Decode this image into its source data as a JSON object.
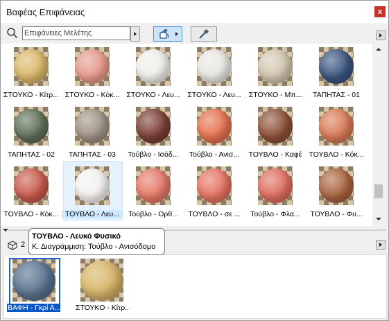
{
  "window": {
    "title": "Βαφέας Επιφάνειας",
    "close": "x"
  },
  "search": {
    "value": "Επιφάνειες Μελέτης"
  },
  "colors": {
    "accent": "#1e63d2",
    "close": "#c9302c"
  },
  "materials": [
    {
      "label": "ΣΤΟΥΚΟ - Κίτρ...",
      "color": "#d9b76a"
    },
    {
      "label": "ΣΤΟΥΚΟ - Κόκ...",
      "color": "#e59a8a"
    },
    {
      "label": "ΣΤΟΥΚΟ - Λευ...",
      "color": "#eeeeea"
    },
    {
      "label": "ΣΤΟΥΚΟ - Λευ...",
      "color": "#e8e6e0"
    },
    {
      "label": "ΣΤΟΥΚΟ - Μπ...",
      "color": "#d2c6b0"
    },
    {
      "label": "ΤΑΠΗΤΑΣ - 01",
      "color": "#3b5580"
    },
    {
      "label": "ΤΑΠΗΤΑΣ - 02",
      "color": "#5f6e56"
    },
    {
      "label": "ΤΑΠΗΤΑΣ - 03",
      "color": "#9e9283"
    },
    {
      "label": "Τούβλο - Ισόδ...",
      "color": "#7b3f36"
    },
    {
      "label": "Τούβλο - Ανισ...",
      "color": "#e5714f"
    },
    {
      "label": "ΤΟΥΒΛΟ - Καφέ",
      "color": "#8c5037"
    },
    {
      "label": "ΤΟΥΒΛΟ - Κόκ...",
      "color": "#d97a55"
    },
    {
      "label": "ΤΟΥΒΛΟ - Κόκ...",
      "color": "#c85a4c"
    },
    {
      "label": "ΤΟΥΒΛΟ - Λευ...",
      "color": "#f2f1ee"
    },
    {
      "label": "Τούβλο - Ορθ...",
      "color": "#e57a68"
    },
    {
      "label": "ΤΟΥΒΛΟ - σε ...",
      "color": "#e47362"
    },
    {
      "label": "Τούβλο - Φλα...",
      "color": "#de6e5e"
    },
    {
      "label": "ΤΟΥΒΛΟ - Φυ...",
      "color": "#a9633f"
    }
  ],
  "tooltip": {
    "title": "ΤΟΥΒΛΟ - Λευκό Φυσικό",
    "subtitle": "Κ. Διαγράμμιση: Τούβλο - Ανισόδομο"
  },
  "model": {
    "count": "2"
  },
  "model_materials": [
    {
      "label": "ΒΑΦΗ - Γκρί Α...",
      "color": "#5a7590",
      "selected": true
    },
    {
      "label": "ΣΤΟΥΚΟ - Κίτρ...",
      "color": "#d9b76a",
      "selected": false
    }
  ]
}
